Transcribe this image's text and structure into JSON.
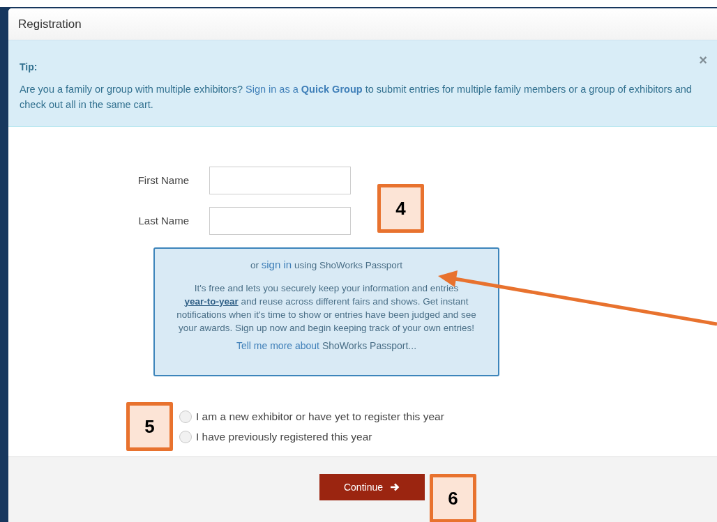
{
  "window": {
    "title": "Registration"
  },
  "tip": {
    "close": "×",
    "heading": "Tip:",
    "text": [
      {
        "kind": "plain",
        "text": "Are you a family or group with multiple exhibitors?"
      },
      {
        "kind": "link",
        "text": "Sign in as a **Quick Group**"
      },
      {
        "kind": "plain",
        "text": "to submit entries for multiple family members or a group of exhibitors and check out all in the same cart."
      }
    ]
  },
  "fields": [
    {
      "label": "First Name"
    },
    {
      "label": "Last Name"
    }
  ],
  "passport": {
    "intro": [
      {
        "kind": "plain",
        "text": "or"
      },
      {
        "kind": "link",
        "text": "sign in"
      },
      {
        "kind": "plain",
        "text": "using ShoWorks Passport"
      }
    ],
    "body": [
      {
        "kind": "plain",
        "text": "It's free and lets you securely keep your information and entries"
      },
      {
        "kind": "strong-link",
        "text": "year-to-year"
      },
      {
        "kind": "plain",
        "text": "and reuse across different fairs and shows. Get instant notifications when it's time to show or entries have been judged and see your awards. Sign up now and begin keeping track of your own entries!"
      }
    ],
    "more": [
      {
        "kind": "link",
        "text": "Tell me more about"
      },
      {
        "kind": "plain",
        "text": "ShoWorks Passport..."
      }
    ]
  },
  "radios": [
    {
      "label": "I am a new exhibitor or have yet to register this year",
      "selected": false
    },
    {
      "label": "I have previously registered this year",
      "selected": false
    }
  ],
  "continue_button": {
    "label": "Continue"
  },
  "callouts": [
    {
      "number": "4"
    },
    {
      "number": "5"
    },
    {
      "number": "6"
    }
  ]
}
